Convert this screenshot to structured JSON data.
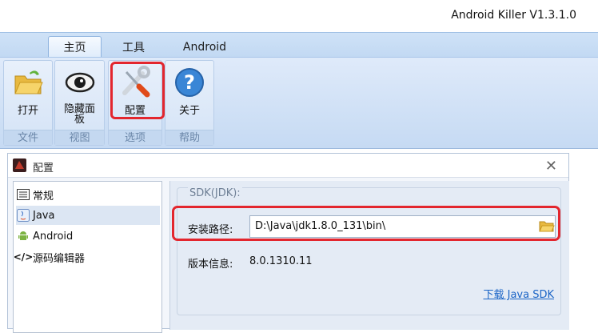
{
  "app": {
    "title": "Android Killer V1.3.1.0"
  },
  "ribbon": {
    "tabs": [
      {
        "label": "主页",
        "active": true
      },
      {
        "label": "工具",
        "active": false
      },
      {
        "label": "Android",
        "active": false
      }
    ],
    "groups": [
      {
        "label": "文件",
        "buttons": [
          {
            "label": "打开",
            "icon": "folder-open-icon"
          }
        ]
      },
      {
        "label": "视图",
        "buttons": [
          {
            "label": "隐藏面板",
            "icon": "eye-icon"
          }
        ]
      },
      {
        "label": "选项",
        "buttons": [
          {
            "label": "配置",
            "icon": "wrench-screwdriver-icon"
          }
        ]
      },
      {
        "label": "帮助",
        "buttons": [
          {
            "label": "关于",
            "icon": "help-icon"
          }
        ]
      }
    ]
  },
  "dialog": {
    "title": "配置",
    "nav": [
      {
        "label": "常规",
        "icon": "list-icon",
        "selected": false
      },
      {
        "label": "Java",
        "icon": "java-icon",
        "selected": true
      },
      {
        "label": "Android",
        "icon": "android-icon",
        "selected": false
      },
      {
        "label": "源码编辑器",
        "icon": "code-icon",
        "selected": false
      }
    ],
    "sdk": {
      "legend": "SDK(JDK):",
      "path_label": "安装路径:",
      "path_value": "D:\\Java\\jdk1.8.0_131\\bin\\",
      "version_label": "版本信息:",
      "version_value": "8.0.1310.11",
      "download_link": "下载 Java SDK"
    }
  },
  "colors": {
    "highlight": "#e3262e",
    "link": "#1a64c6",
    "ribbon": "#cddff5"
  }
}
